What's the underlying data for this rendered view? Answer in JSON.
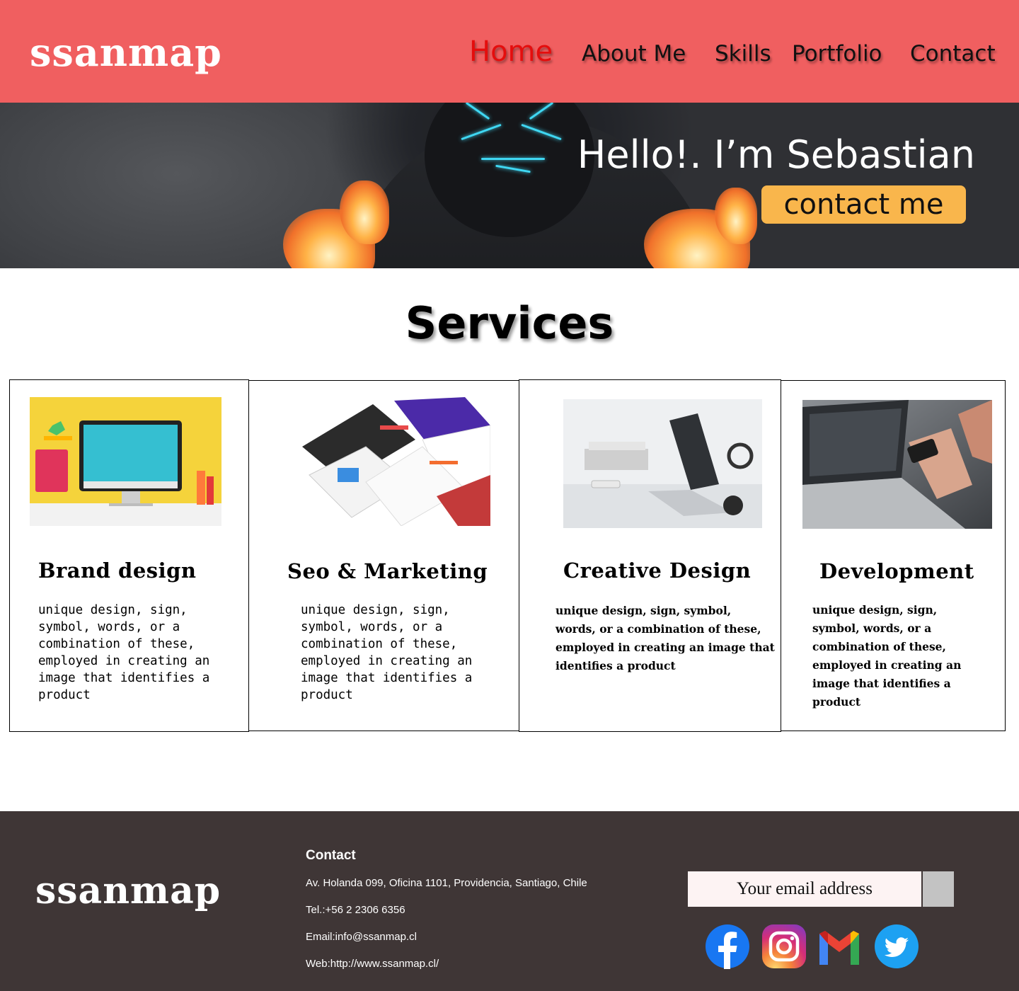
{
  "header": {
    "logo": "ssanmap",
    "nav": [
      {
        "label": "Home",
        "active": true
      },
      {
        "label": "About Me",
        "active": false
      },
      {
        "label": "Skills",
        "active": false
      },
      {
        "label": "Portfolio",
        "active": false
      },
      {
        "label": "Contact",
        "active": false
      }
    ]
  },
  "hero": {
    "greeting": "Hello!. I’m Sebastian",
    "button_label": "contact me"
  },
  "services": {
    "title": "Services",
    "cards": [
      {
        "title": "Brand design",
        "text": "unique design, sign, symbol, words, or a combination of these, employed in creating an image that identifies a product",
        "image": "imac-workspace-photo"
      },
      {
        "title": "Seo & Marketing",
        "text": "unique design, sign, symbol, words, or a combination of these, employed in creating an image that identifies a product",
        "image": "website-mockups-photo"
      },
      {
        "title": "Creative Design",
        "text": "unique design, sign, symbol, words, or a combination of these, employed in creating an image that identifies a product",
        "image": "laptop-desk-photo"
      },
      {
        "title": "Development",
        "text": "unique design, sign, symbol, words, or a combination of these, employed in creating an image that identifies a product",
        "image": "laptop-phone-hands-photo"
      }
    ]
  },
  "footer": {
    "logo": "ssanmap",
    "contact_heading": "Contact",
    "address": "Av. Holanda 099, Oficina 1101, Providencia, Santiago, Chile",
    "phone": "Tel.:+56 2 2306 6356",
    "email": "Email:info@ssanmap.cl",
    "web": "Web:http://www.ssanmap.cl/",
    "newsletter_placeholder": "Your email address",
    "social": [
      "facebook-icon",
      "instagram-icon",
      "gmail-icon",
      "twitter-icon"
    ]
  },
  "colors": {
    "header_bg": "#f05f60",
    "nav_active": "#e50d0d",
    "cta_bg": "#f9b64c",
    "footer_bg": "#3f3636"
  }
}
